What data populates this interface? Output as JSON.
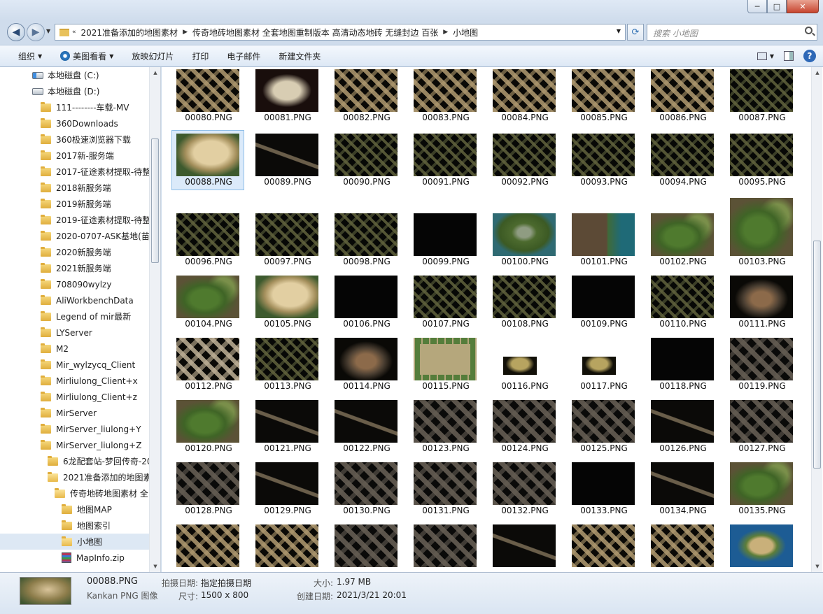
{
  "window": {
    "min_label": "─",
    "max_label": "□",
    "close_label": "✕"
  },
  "address": {
    "segments": [
      "2021准备添加的地图素材",
      "传奇地砖地图素材 全套地图重制版本 高清动态地砖 无缝封边 百张",
      "小地图"
    ],
    "prefix": "«",
    "search_placeholder": "搜索 小地图"
  },
  "toolbar": {
    "organize": "组织",
    "view_with": "美图看看",
    "slideshow": "放映幻灯片",
    "print": "打印",
    "email": "电子邮件",
    "new_folder": "新建文件夹"
  },
  "tree": [
    {
      "label": "本地磁盘 (C:)",
      "type": "drive-sys",
      "indent": 46
    },
    {
      "label": "本地磁盘 (D:)",
      "type": "drive",
      "indent": 46
    },
    {
      "label": "111--------车载-MV",
      "type": "folder",
      "indent": 58
    },
    {
      "label": "360Downloads",
      "type": "folder",
      "indent": 58
    },
    {
      "label": "360极速浏览器下载",
      "type": "folder",
      "indent": 58
    },
    {
      "label": "2017新-服务端",
      "type": "folder",
      "indent": 58
    },
    {
      "label": "2017-征途素材提取-待整",
      "type": "folder",
      "indent": 58
    },
    {
      "label": "2018新服务端",
      "type": "folder",
      "indent": 58
    },
    {
      "label": "2019新服务端",
      "type": "folder",
      "indent": 58
    },
    {
      "label": "2019-征途素材提取-待整",
      "type": "folder",
      "indent": 58
    },
    {
      "label": "2020-0707-ASK基地(苗木",
      "type": "folder",
      "indent": 58
    },
    {
      "label": "2020新服务端",
      "type": "folder",
      "indent": 58
    },
    {
      "label": "2021新服务端",
      "type": "folder",
      "indent": 58
    },
    {
      "label": "708090wylzy",
      "type": "folder",
      "indent": 58
    },
    {
      "label": "AliWorkbenchData",
      "type": "folder",
      "indent": 58
    },
    {
      "label": "Legend of mir最新",
      "type": "folder",
      "indent": 58
    },
    {
      "label": "LYServer",
      "type": "folder",
      "indent": 58
    },
    {
      "label": "M2",
      "type": "folder",
      "indent": 58
    },
    {
      "label": "Mir_wylzycq_Client",
      "type": "folder",
      "indent": 58
    },
    {
      "label": "Mirliulong_Client+x",
      "type": "folder",
      "indent": 58
    },
    {
      "label": "Mirliulong_Client+z",
      "type": "folder",
      "indent": 58
    },
    {
      "label": "MirServer",
      "type": "folder",
      "indent": 58
    },
    {
      "label": "MirServer_liulong+Y",
      "type": "folder",
      "indent": 58
    },
    {
      "label": "MirServer_liulong+Z",
      "type": "folder",
      "indent": 58
    },
    {
      "label": "6龙配套站-梦回传奇-20",
      "type": "folder",
      "indent": 68
    },
    {
      "label": "2021准备添加的地图素",
      "type": "folder-open",
      "indent": 68
    },
    {
      "label": "传奇地砖地图素材 全",
      "type": "folder-open",
      "indent": 78
    },
    {
      "label": "地图MAP",
      "type": "folder",
      "indent": 88
    },
    {
      "label": "地图索引",
      "type": "folder",
      "indent": 88
    },
    {
      "label": "小地图",
      "type": "folder-open",
      "indent": 88,
      "selected": true
    },
    {
      "label": "MapInfo.zip",
      "type": "zip",
      "indent": 88
    }
  ],
  "files": [
    {
      "name": "00080.PNG",
      "style": "brownmaze"
    },
    {
      "name": "00081.PNG",
      "style": "paleblob"
    },
    {
      "name": "00082.PNG",
      "style": "brownmaze"
    },
    {
      "name": "00083.PNG",
      "style": "brownmaze"
    },
    {
      "name": "00084.PNG",
      "style": "brownmaze"
    },
    {
      "name": "00085.PNG",
      "style": "brownmaze"
    },
    {
      "name": "00086.PNG",
      "style": "brownmaze"
    },
    {
      "name": "00087.PNG",
      "style": "olivemaze"
    },
    {
      "name": "00088.PNG",
      "style": "sandisland",
      "selected": true
    },
    {
      "name": "00089.PNG",
      "style": "diagonal"
    },
    {
      "name": "00090.PNG",
      "style": "olivemaze"
    },
    {
      "name": "00091.PNG",
      "style": "olivemaze"
    },
    {
      "name": "00092.PNG",
      "style": "olivemaze"
    },
    {
      "name": "00093.PNG",
      "style": "olivemaze"
    },
    {
      "name": "00094.PNG",
      "style": "olivemaze"
    },
    {
      "name": "00095.PNG",
      "style": "olivemaze"
    },
    {
      "name": "00096.PNG",
      "style": "olivemaze"
    },
    {
      "name": "00097.PNG",
      "style": "olivemaze"
    },
    {
      "name": "00098.PNG",
      "style": "olivemaze"
    },
    {
      "name": "00099.PNG",
      "style": "black"
    },
    {
      "name": "00100.PNG",
      "style": "greencity"
    },
    {
      "name": "00101.PNG",
      "style": "greencoast"
    },
    {
      "name": "00102.PNG",
      "style": "greenland"
    },
    {
      "name": "00103.PNG",
      "style": "greenland"
    },
    {
      "name": "00104.PNG",
      "style": "greenland"
    },
    {
      "name": "00105.PNG",
      "style": "sandisland"
    },
    {
      "name": "00106.PNG",
      "style": "black"
    },
    {
      "name": "00107.PNG",
      "style": "olivemaze"
    },
    {
      "name": "00108.PNG",
      "style": "olivemaze"
    },
    {
      "name": "00109.PNG",
      "style": "black"
    },
    {
      "name": "00110.PNG",
      "style": "olivemaze"
    },
    {
      "name": "00111.PNG",
      "style": "brownroom"
    },
    {
      "name": "00112.PNG",
      "style": "palemaze"
    },
    {
      "name": "00113.PNG",
      "style": "olivemaze"
    },
    {
      "name": "00114.PNG",
      "style": "brownroom"
    },
    {
      "name": "00115.PNG",
      "style": "greenfield"
    },
    {
      "name": "00116.PNG",
      "style": "smallisland"
    },
    {
      "name": "00117.PNG",
      "style": "smallisland"
    },
    {
      "name": "00118.PNG",
      "style": "black"
    },
    {
      "name": "00119.PNG",
      "style": "greymaze"
    },
    {
      "name": "00120.PNG",
      "style": "greenland"
    },
    {
      "name": "00121.PNG",
      "style": "diagonal"
    },
    {
      "name": "00122.PNG",
      "style": "diagonal"
    },
    {
      "name": "00123.PNG",
      "style": "greymaze"
    },
    {
      "name": "00124.PNG",
      "style": "greymaze"
    },
    {
      "name": "00125.PNG",
      "style": "greymaze"
    },
    {
      "name": "00126.PNG",
      "style": "diagonal"
    },
    {
      "name": "00127.PNG",
      "style": "greymaze"
    },
    {
      "name": "00128.PNG",
      "style": "greymaze"
    },
    {
      "name": "00129.PNG",
      "style": "diagonal"
    },
    {
      "name": "00130.PNG",
      "style": "greymaze"
    },
    {
      "name": "00131.PNG",
      "style": "greymaze"
    },
    {
      "name": "00132.PNG",
      "style": "greymaze"
    },
    {
      "name": "00133.PNG",
      "style": "black"
    },
    {
      "name": "00134.PNG",
      "style": "diagonal"
    },
    {
      "name": "00135.PNG",
      "style": "greenland"
    },
    {
      "name": "",
      "style": "brownmaze"
    },
    {
      "name": "",
      "style": "brownmaze"
    },
    {
      "name": "",
      "style": "greymaze"
    },
    {
      "name": "",
      "style": "greymaze"
    },
    {
      "name": "",
      "style": "diagonal"
    },
    {
      "name": "",
      "style": "brownmaze"
    },
    {
      "name": "",
      "style": "brownmaze"
    },
    {
      "name": "",
      "style": "seaisland"
    }
  ],
  "details": {
    "filename": "00088.PNG",
    "filetype": "Kankan PNG 图像",
    "taken_label": "拍摄日期:",
    "taken_value": "指定拍摄日期",
    "size_label": "尺寸:",
    "size_value": "1500 x 800",
    "filesize_label": "大小:",
    "filesize_value": "1.97 MB",
    "created_label": "创建日期:",
    "created_value": "2021/3/21 20:01"
  }
}
